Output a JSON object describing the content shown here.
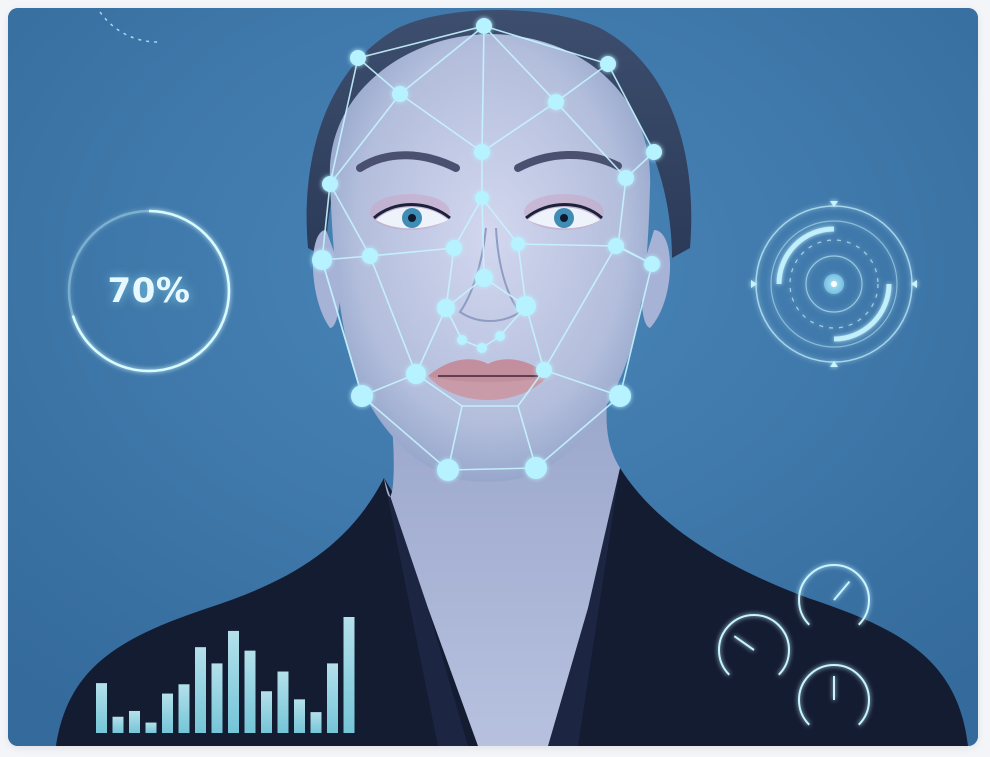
{
  "hud": {
    "match_label": "70%",
    "match_fraction": 0.7
  },
  "colors": {
    "background": "#3b73a6",
    "hud_cyan": "#a8f4ff",
    "jacket": "#141c32",
    "skin": "#b9c4e0"
  },
  "bars": {
    "levels": [
      0.43,
      0.14,
      0.19,
      0.09,
      0.34,
      0.42,
      0.74,
      0.6,
      0.88,
      0.71,
      0.36,
      0.53,
      0.29,
      0.18,
      0.6,
      1.0
    ]
  },
  "gauges": {
    "needles": [
      {
        "name": "gauge-top",
        "angle_deg": 40
      },
      {
        "name": "gauge-left",
        "angle_deg": -55
      },
      {
        "name": "gauge-bottom",
        "angle_deg": 0
      }
    ]
  },
  "icons": {
    "face_mesh": "face-mesh-icon",
    "target": "target-reticle-icon"
  }
}
